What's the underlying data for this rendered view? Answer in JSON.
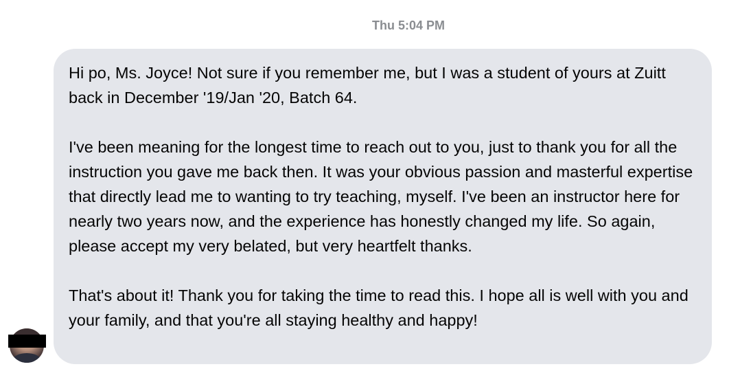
{
  "thread": {
    "timestamp": "Thu 5:04 PM"
  },
  "message": {
    "paragraphs": [
      "Hi po, Ms. Joyce! Not sure if you remember me, but I was a student of yours at Zuitt back in December '19/Jan '20, Batch 64.",
      "I've been meaning for the longest time to reach out to you, just to thank you for all the instruction you gave me back then. It was your obvious passion and masterful expertise that directly lead me to wanting to try teaching, myself. I've been an instructor here for nearly two years now, and the experience has honestly changed my life. So again, please accept my very belated, but very heartfelt thanks.",
      "That's about it! Thank you for taking the time to read this. I hope all is well with you and your family, and that you're all staying healthy and happy!"
    ]
  }
}
